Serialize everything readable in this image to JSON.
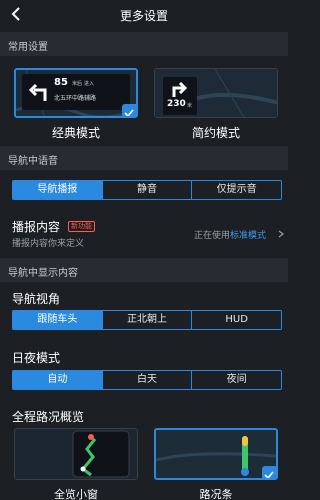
{
  "header": {
    "title": "更多设置"
  },
  "sections": {
    "common": "常用设置",
    "voice": "导航中语音",
    "display": "导航中显示内容"
  },
  "modes": {
    "classic": {
      "label": "经典模式",
      "selected": true,
      "distance": "85",
      "unit": "米后",
      "action": "进入",
      "road": "北五环中路辅路"
    },
    "simple": {
      "label": "简约模式",
      "selected": false,
      "distance": "230",
      "unit": "米"
    }
  },
  "voice_options": [
    "导航播报",
    "静音",
    "仅提示音"
  ],
  "voice_selected": 0,
  "broadcast": {
    "title": "播报内容",
    "badge": "新功能",
    "subtitle": "播报内容你来定义",
    "status_prefix": "正在使用",
    "status_link": "标准模式"
  },
  "view": {
    "title": "导航视角",
    "options": [
      "跟随车头",
      "正北朝上",
      "HUD"
    ],
    "selected": 0
  },
  "daynight": {
    "title": "日夜模式",
    "options": [
      "自动",
      "白天",
      "夜间"
    ],
    "selected": 0
  },
  "overview": {
    "title": "全程路况概览",
    "left_label": "全览小窗",
    "right_label": "路况条",
    "right_selected": true
  },
  "colors": {
    "accent": "#2b8ae0",
    "background": "#1c1f24",
    "section": "#272b32",
    "badge": "#ff5a4a"
  },
  "icons": [
    "back-arrow-icon",
    "turn-left-icon",
    "turn-right-icon",
    "checkmark-icon",
    "chevron-right-icon",
    "map-pin-icon",
    "car-icon"
  ]
}
